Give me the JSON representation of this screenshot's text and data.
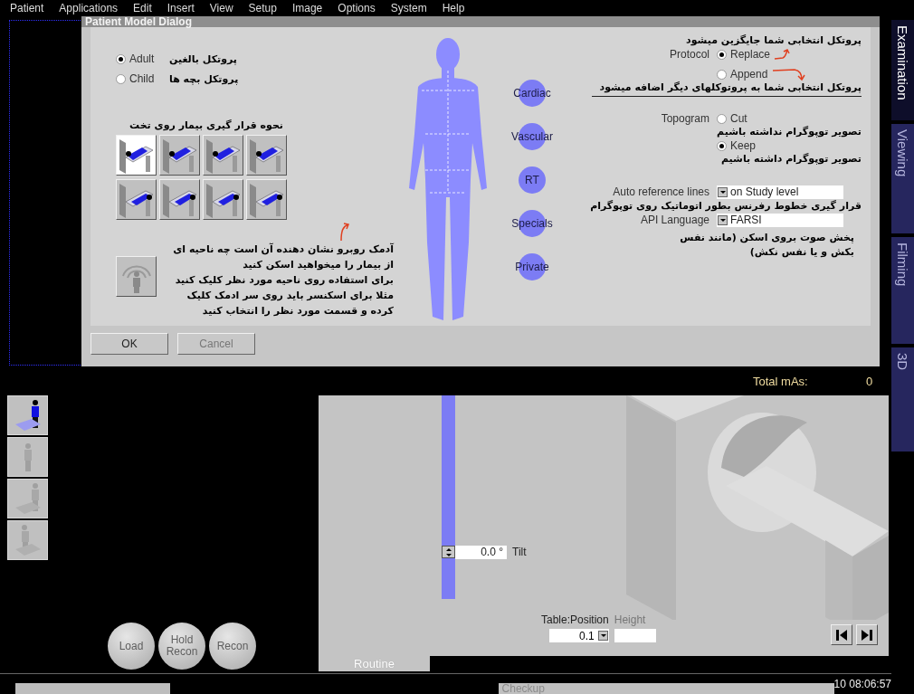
{
  "menu": [
    "Patient",
    "Applications",
    "Edit",
    "Insert",
    "View",
    "Setup",
    "Image",
    "Options",
    "System",
    "Help"
  ],
  "side_tabs": [
    {
      "label": "Examination",
      "selected": true
    },
    {
      "label": "Viewing",
      "selected": false
    },
    {
      "label": "Filming",
      "selected": false
    },
    {
      "label": "3D",
      "selected": false
    }
  ],
  "dialog": {
    "title": "Patient Model Dialog",
    "age_options": [
      {
        "label": "Adult",
        "note": "پروتکل بالغین",
        "selected": true
      },
      {
        "label": "Child",
        "note": "پروتکل بچه ها",
        "selected": false
      }
    ],
    "position_heading": "نحوه قرار گیری بیمار روی تخت",
    "positions": [
      {
        "selected": true
      },
      {
        "selected": false
      },
      {
        "selected": false
      },
      {
        "selected": false
      },
      {
        "selected": false
      },
      {
        "selected": false
      },
      {
        "selected": false
      },
      {
        "selected": false
      }
    ],
    "region_help": [
      "آدمک روبرو نشان دهنده آن است چه ناحیه ای",
      "از بیمار را میخواهید اسکن کنید",
      "برای استفاده روی ناحیه مورد نظر کلیک کنید",
      "مثلا برای اسکنسر باید روی سر ادمک کلیک",
      "کرده و قسمت مورد نظر را انتخاب کنید"
    ],
    "regions": [
      "Cardiac",
      "Vascular",
      "RT",
      "Specials",
      "Private"
    ],
    "protocol": {
      "label": "Protocol",
      "replace_note": "پروتکل انتخابی شما جایگزین میشود",
      "options": [
        {
          "label": "Replace",
          "selected": true
        },
        {
          "label": "Append",
          "selected": false
        }
      ],
      "append_note": "پروتکل انتخابی شما به پروتوکلهای دیگر اضافه میشود"
    },
    "topogram": {
      "label": "Topogram",
      "options": [
        {
          "label": "Cut",
          "selected": false,
          "note": "تصویر توپوگرام نداشته باشیم"
        },
        {
          "label": "Keep",
          "selected": true,
          "note": "تصویر توپوگرام داشته باشیم"
        }
      ]
    },
    "auto_reference": {
      "label": "Auto reference lines",
      "value": "on Study level",
      "note": "قرار گیری خطوط رفرنس بطور اتوماتیک روی توپوگرام"
    },
    "api_language": {
      "label": "API Language",
      "value": "FARSI",
      "note": "پخش صوت بروی اسکن (مانند نفس بکش و یا نفس نکش)"
    },
    "buttons": [
      {
        "label": "OK",
        "disabled": false
      },
      {
        "label": "Cancel",
        "disabled": true
      }
    ]
  },
  "total_mas": {
    "label": "Total mAs:",
    "value": "0"
  },
  "mode_buttons": [
    {
      "selected": true
    },
    {
      "selected": false
    },
    {
      "selected": false
    },
    {
      "selected": false
    }
  ],
  "round_buttons": [
    {
      "label": "Load",
      "disabled": true
    },
    {
      "label": "Hold Recon",
      "disabled": true
    },
    {
      "label": "Recon",
      "disabled": true
    }
  ],
  "gantry": {
    "tilt": {
      "value": "0.0 °",
      "label": "Tilt"
    },
    "table_position": {
      "label": "Table:Position",
      "value": "0.1"
    },
    "height": {
      "label": "Height",
      "disabled": true
    },
    "tab": "Routine"
  },
  "taskbar": {
    "window": "Checkup",
    "clock": "10 08:06:57"
  }
}
